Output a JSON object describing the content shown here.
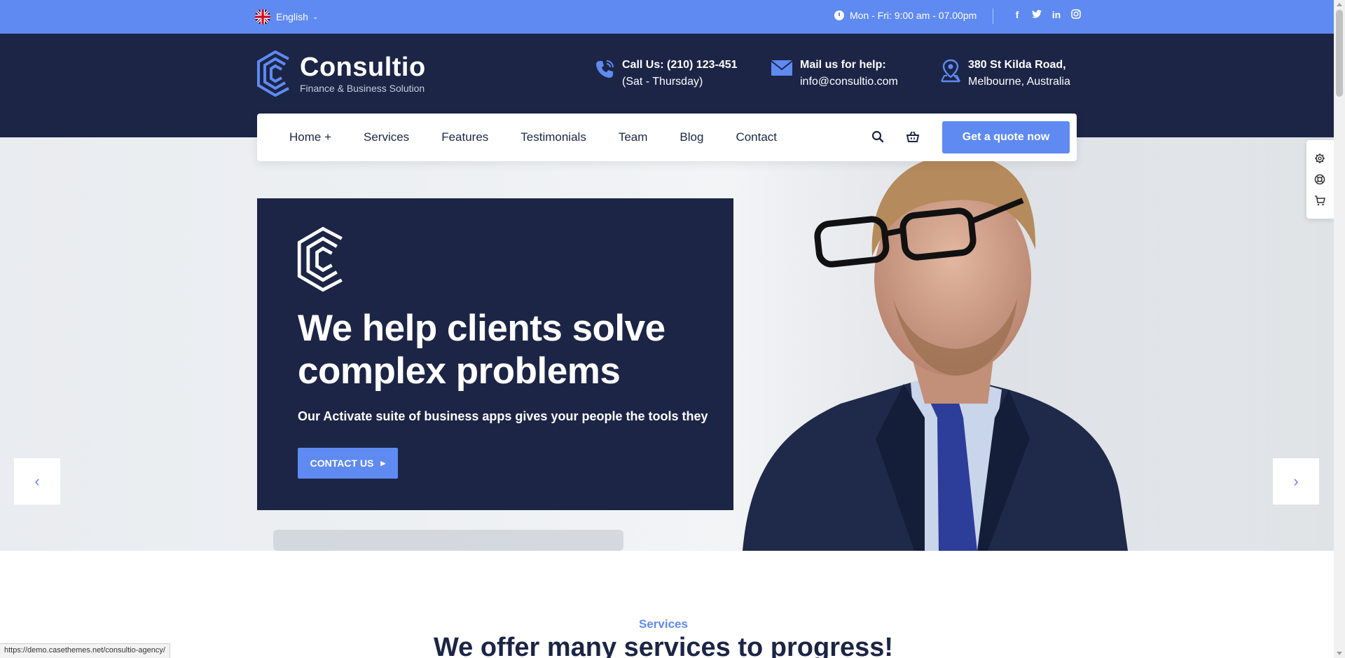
{
  "colors": {
    "accent": "#5f8af2",
    "navy": "#1c2546",
    "white": "#ffffff"
  },
  "topbar": {
    "language": "English",
    "hours": "Mon - Fri: 9:00 am - 07.00pm",
    "social": [
      "facebook-icon",
      "twitter-icon",
      "linkedin-icon",
      "instagram-icon"
    ]
  },
  "brand": {
    "name": "Consultio",
    "tagline": "Finance & Business Solution"
  },
  "header_contacts": [
    {
      "icon": "phone-icon",
      "title": "Call Us: (210) 123-451",
      "line2": "(Sat - Thursday)"
    },
    {
      "icon": "mail-icon",
      "title": "Mail us for help:",
      "line2": "info@consultio.com"
    },
    {
      "icon": "location-pin-icon",
      "title": "380 St Kilda Road,",
      "line2": "Melbourne, Australia"
    }
  ],
  "nav": {
    "items": [
      "Home +",
      "Services",
      "Features",
      "Testimonials",
      "Team",
      "Blog",
      "Contact"
    ],
    "quote_button": "Get a quote now"
  },
  "hero": {
    "title": "We help clients solve complex problems",
    "subtitle": "Our Activate suite of business apps gives your people the tools they",
    "button": "CONTACT US"
  },
  "services": {
    "label": "Services",
    "title": "We offer many services to progress!"
  },
  "status_url": "https://demo.casethemes.net/consultio-agency/"
}
